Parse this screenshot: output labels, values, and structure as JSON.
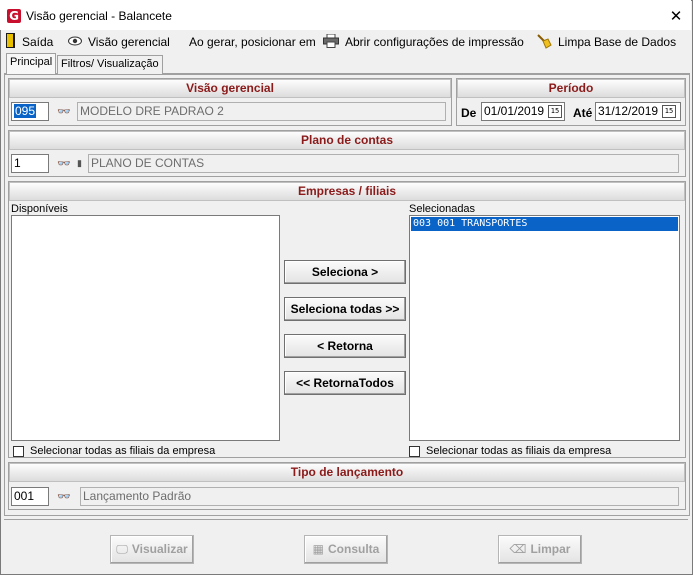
{
  "window": {
    "title": "Visão gerencial - Balancete",
    "close_glyph": "✕"
  },
  "toolbar": {
    "exit_label": "Saída",
    "visao_label": "Visão gerencial",
    "position_label": "Ao gerar, posicionar em",
    "print_config_label": "Abrir configurações de impressão",
    "clear_base_label": "Limpa Base de Dados"
  },
  "tabs": [
    {
      "label": "Principal",
      "active": true
    },
    {
      "label": "Filtros/ Visualização",
      "active": false
    }
  ],
  "visao": {
    "heading": "Visão gerencial",
    "code": "095",
    "name": "MODELO DRE PADRAO 2"
  },
  "periodo": {
    "heading": "Período",
    "from_label": "De",
    "from_value": "01/01/2019",
    "to_label": "Até",
    "to_value": "31/12/2019",
    "cal_glyph": "15"
  },
  "plano": {
    "heading": "Plano de contas",
    "code": "1",
    "name": "PLANO DE CONTAS"
  },
  "empresas": {
    "heading": "Empresas / filiais",
    "available_label": "Disponíveis",
    "selected_label": "Selecionadas",
    "available_items": [],
    "selected_items": [
      "003  001 TRANSPORTES"
    ],
    "select_all_left": "Selecionar todas as filiais da empresa",
    "select_all_right": "Selecionar todas as filiais da empresa"
  },
  "transfer_buttons": {
    "select": "Seleciona >",
    "select_all": "Seleciona todas >>",
    "back": "< Retorna",
    "back_all": "<< RetornaTodos"
  },
  "tipo": {
    "heading": "Tipo de lançamento",
    "code": "001",
    "name": "Lançamento Padrão"
  },
  "footer": {
    "visualizar": "Visualizar",
    "consulta": "Consulta",
    "limpar": "Limpar"
  },
  "colors": {
    "accent_heading": "#8b1a1a",
    "selection": "#0a64c8",
    "app_icon": "#c8102e"
  }
}
